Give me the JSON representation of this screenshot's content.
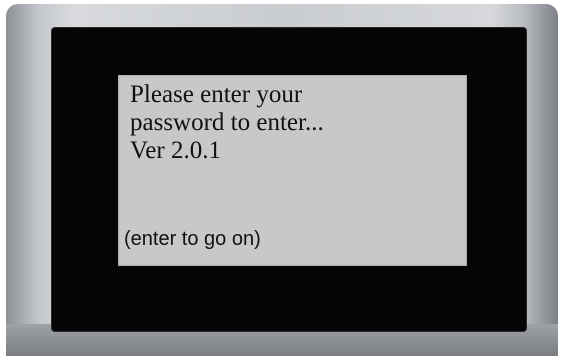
{
  "screen": {
    "prompt_line_1": "Please enter your",
    "prompt_line_2": "password to enter...",
    "version": "Ver 2.0.1",
    "continue_hint": "(enter to go on)"
  },
  "colors": {
    "lcd_background": "#c8c8c8",
    "bezel": "#050505",
    "text": "#111111",
    "casing": "#c9ccd0"
  }
}
